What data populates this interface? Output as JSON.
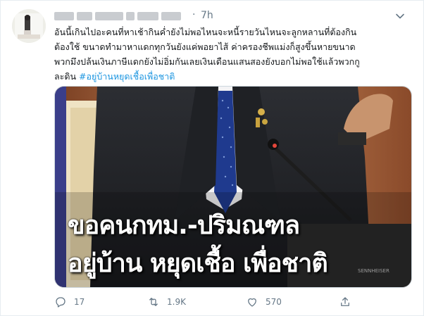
{
  "tweet": {
    "time": "7h",
    "separator": "·",
    "body_line1": "อันนี้เกินไปอะคนที่หาเช้ากินค่ำยังไม่พอไหนจะหนี้รายวันไหนจะลูกหลานที่ต้องกิน",
    "body_line2": "ต้องใช้ ขนาดทำมาหาแดกทุกวันยังแค่พอยาไส้ ค่าครองชีพแม่งก็สูงขึ้นหายขนาด",
    "body_line3": "พวกมึงปล้นเงินภาษีแดกยังไม่อิ่มกันเลยเงินเดือนแสนสองยังบอกไม่พอใช้แล้วพวกกู",
    "body_line4_prefix": "ละดิน ",
    "hashtag": "#อยู่บ้านหยุดเชื้อเพื่อชาติ"
  },
  "media": {
    "caption_line1": "ขอคนกทม.-ปริมณฑล",
    "caption_line2": "อยู่บ้าน หยุดเชื้อ เพื่อชาติ",
    "brand_text": "SENNHEISER"
  },
  "actions": {
    "reply_count": "17",
    "retweet_count": "1.9K",
    "like_count": "570"
  },
  "icons": {
    "more": "chevron-down-icon",
    "reply": "reply-icon",
    "retweet": "retweet-icon",
    "like": "heart-icon",
    "share": "share-icon"
  },
  "colors": {
    "hashtag": "#1b95e0",
    "action_gray": "#657786"
  }
}
